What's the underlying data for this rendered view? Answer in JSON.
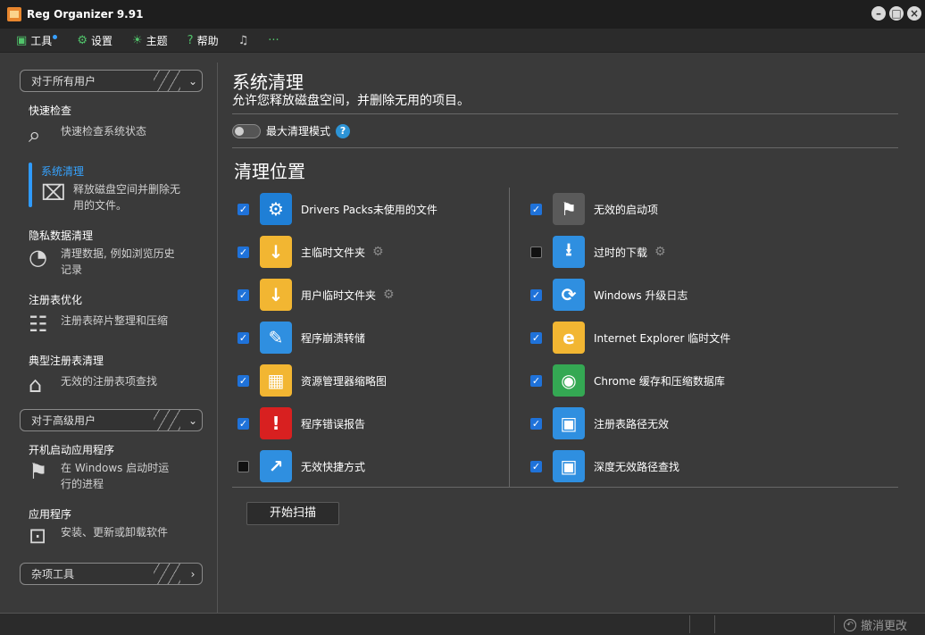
{
  "app": {
    "title": "Reg Organizer 9.91"
  },
  "menu": [
    {
      "label": "工具",
      "icon": "toolbox-icon"
    },
    {
      "label": "设置",
      "icon": "gear-icon"
    },
    {
      "label": "主题",
      "icon": "lightbulb-icon"
    },
    {
      "label": "帮助",
      "icon": "help-icon"
    }
  ],
  "sidebar": {
    "group_all_users": "对于所有用户",
    "group_advanced": "对于高级用户",
    "group_misc": "杂项工具",
    "items": [
      {
        "title": "快速检查",
        "desc": "快速检查系统状态"
      },
      {
        "title": "系统清理",
        "desc": "释放磁盘空间并删除无用的文件。"
      },
      {
        "title": "隐私数据清理",
        "desc": "清理数据, 例如浏览历史记录"
      },
      {
        "title": "注册表优化",
        "desc": "注册表碎片整理和压缩"
      },
      {
        "title": "典型注册表清理",
        "desc": "无效的注册表项查找"
      },
      {
        "title": "开机启动应用程序",
        "desc": "在 Windows 启动时运行的进程"
      },
      {
        "title": "应用程序",
        "desc": "安装、更新或卸载软件"
      }
    ]
  },
  "main": {
    "title": "系统清理",
    "subtitle": "允许您释放磁盘空间，并删除无用的项目。",
    "max_mode_label": "最大清理模式",
    "section_title": "清理位置",
    "left_items": [
      {
        "label": "Drivers Packs未使用的文件",
        "checked": true,
        "icon": "drivers-gear-icon",
        "color": "#1f7fd6",
        "glyph": "⚙"
      },
      {
        "label": "主临时文件夹",
        "checked": true,
        "icon": "temp-folder-icon",
        "color": "#f2b632",
        "glyph": "↓",
        "settings": true
      },
      {
        "label": "用户临时文件夹",
        "checked": true,
        "icon": "user-temp-folder-icon",
        "color": "#f2b632",
        "glyph": "↓",
        "settings": true
      },
      {
        "label": "程序崩溃转储",
        "checked": true,
        "icon": "crash-dump-icon",
        "color": "#2f8fe0",
        "glyph": "✎"
      },
      {
        "label": "资源管理器缩略图",
        "checked": true,
        "icon": "thumbnail-folder-icon",
        "color": "#f2b632",
        "glyph": "▦"
      },
      {
        "label": "程序错误报告",
        "checked": true,
        "icon": "error-report-icon",
        "color": "#d82020",
        "glyph": "!"
      },
      {
        "label": "无效快捷方式",
        "checked": false,
        "icon": "broken-shortcut-icon",
        "color": "#2f8fe0",
        "glyph": "↗"
      }
    ],
    "right_items": [
      {
        "label": "无效的启动项",
        "checked": true,
        "icon": "startup-flag-icon",
        "color": "#5a5a5a",
        "glyph": "⚑"
      },
      {
        "label": "过时的下载",
        "checked": false,
        "icon": "download-icon",
        "color": "#2f8fe0",
        "glyph": "⭳",
        "settings": true
      },
      {
        "label": "Windows 升级日志",
        "checked": true,
        "icon": "update-log-icon",
        "color": "#2f8fe0",
        "glyph": "⟳"
      },
      {
        "label": "Internet Explorer 临时文件",
        "checked": true,
        "icon": "ie-folder-icon",
        "color": "#f2b632",
        "glyph": "e"
      },
      {
        "label": "Chrome 缓存和压缩数据库",
        "checked": true,
        "icon": "chrome-icon",
        "color": "#34a853",
        "glyph": "◉"
      },
      {
        "label": "注册表路径无效",
        "checked": true,
        "icon": "registry-path-icon",
        "color": "#2f8fe0",
        "glyph": "▣"
      },
      {
        "label": "深度无效路径查找",
        "checked": true,
        "icon": "deep-path-icon",
        "color": "#2f8fe0",
        "glyph": "▣"
      }
    ],
    "scan_button": "开始扫描"
  },
  "status": {
    "undo_label": "撤消更改"
  }
}
